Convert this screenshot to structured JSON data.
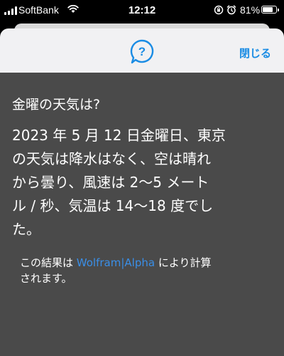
{
  "status_bar": {
    "carrier": "SoftBank",
    "time": "12:12",
    "battery_percent": "81%",
    "battery_level": 0.81
  },
  "header": {
    "help_icon": "speech-question-icon",
    "close_label": "閉じる",
    "accent_color": "#1a8ce4"
  },
  "content": {
    "question": "金曜の天気は?",
    "answer_lines": [
      "2023 年 5 月 12 日金曜日、東京",
      "の天気は降水はなく、空は晴れ",
      "から曇り、風速は 2〜5 メート",
      "ル / 秒、気温は 14〜18 度でし",
      "た。"
    ],
    "credit_prefix": "この結果は ",
    "credit_link": "Wolfram|Alpha",
    "credit_suffix_line1": " により計算",
    "credit_line2": "されます。"
  }
}
